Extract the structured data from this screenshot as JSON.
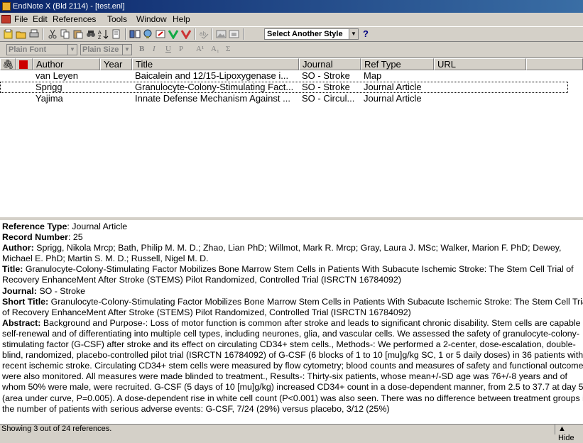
{
  "window": {
    "title": "EndNote X (Bld 2114) - [test.enl]"
  },
  "menu": [
    "File",
    "Edit",
    "References",
    "Tools",
    "Window",
    "Help"
  ],
  "toolbar": {
    "style_select": "Select Another Style",
    "help_label": "?"
  },
  "format_bar": {
    "font": "Plain Font",
    "size": "Plain Size",
    "bold": "B",
    "italic": "I",
    "underline": "U",
    "plain": "P",
    "superscript": "A¹",
    "subscript": "A₁",
    "symbol": "Σ"
  },
  "columns": [
    "Author",
    "Year",
    "Title",
    "Journal",
    "Ref Type",
    "URL"
  ],
  "references": [
    {
      "author": "van Leyen",
      "year": "",
      "title": "Baicalein and 12/15-Lipoxygenase i...",
      "journal": "SO - Stroke",
      "ref_type": "Map",
      "url": ""
    },
    {
      "author": "Sprigg",
      "year": "",
      "title": "Granulocyte-Colony-Stimulating Fact...",
      "journal": "SO - Stroke",
      "ref_type": "Journal Article",
      "url": ""
    },
    {
      "author": "Yajima",
      "year": "",
      "title": "Innate Defense Mechanism Against ...",
      "journal": "SO - Circul...",
      "ref_type": "Journal Article",
      "url": ""
    }
  ],
  "preview": {
    "ref_type_label": "Reference Type",
    "ref_type": "Journal Article",
    "record_label": "Record Number",
    "record": "25",
    "author_label": "Author:",
    "author": "Sprigg, Nikola Mrcp; Bath, Philip M. M. D.; Zhao, Lian PhD; Willmot, Mark R. Mrcp; Gray, Laura J. MSc; Walker, Marion F. PhD; Dewey, Michael E. PhD; Martin S. M. D.; Russell, Nigel M. D.",
    "title_label": "Title:",
    "title": "Granulocyte-Colony-Stimulating Factor Mobilizes Bone Marrow Stem Cells in Patients With Subacute Ischemic Stroke: The Stem Cell Trial of Recovery EnhanceMent After Stroke (STEMS) Pilot Randomized, Controlled Trial (ISRCTN 16784092)",
    "journal_label": "Journal:",
    "journal": "SO - Stroke",
    "short_title_label": "Short Title:",
    "short_title": "Granulocyte-Colony-Stimulating Factor Mobilizes Bone Marrow Stem Cells in Patients With Subacute Ischemic Stroke: The Stem Cell Trial of Recovery EnhanceMent After Stroke (STEMS) Pilot Randomized, Controlled Trial (ISRCTN 16784092)",
    "abstract_label": "Abstract:",
    "abstract": "Background and Purpose-: Loss of motor function is common after stroke and leads to significant chronic disability. Stem cells are capable of self-renewal and of differentiating into multiple cell types, including neurones, glia, and vascular cells. We assessed the safety of granulocyte-colony-stimulating factor (G-CSF) after stroke and its effect on circulating CD34+ stem cells., Methods-: We performed a 2-center, dose-escalation, double-blind, randomized, placebo-controlled pilot trial (ISRCTN 16784092) of G-CSF (6 blocks of 1 to 10 [mu]g/kg SC, 1 or 5 daily doses) in 36 patients with recent ischemic stroke. Circulating CD34+ stem cells were measured by flow cytometry; blood counts and measures of safety and functional outcome were also monitored. All measures were made blinded to treatment., Results-: Thirty-six patients, whose mean+/-SD age was 76+/-8 years and of whom 50% were male, were recruited. G-CSF (5 days of 10 [mu]g/kg) increased CD34+ count in a dose-dependent manner, from 2.5 to 37.7 at day 5 (area under curve, P=0.005). A dose-dependent rise in white cell count (P<0.001) was also seen. There was no difference between treatment groups in the number of patients with serious adverse events: G-CSF, 7/24 (29%) versus placebo, 3/12 (25%)"
  },
  "status": {
    "text": "Showing 3 out of 24 references.",
    "hide_label": "Hide"
  }
}
